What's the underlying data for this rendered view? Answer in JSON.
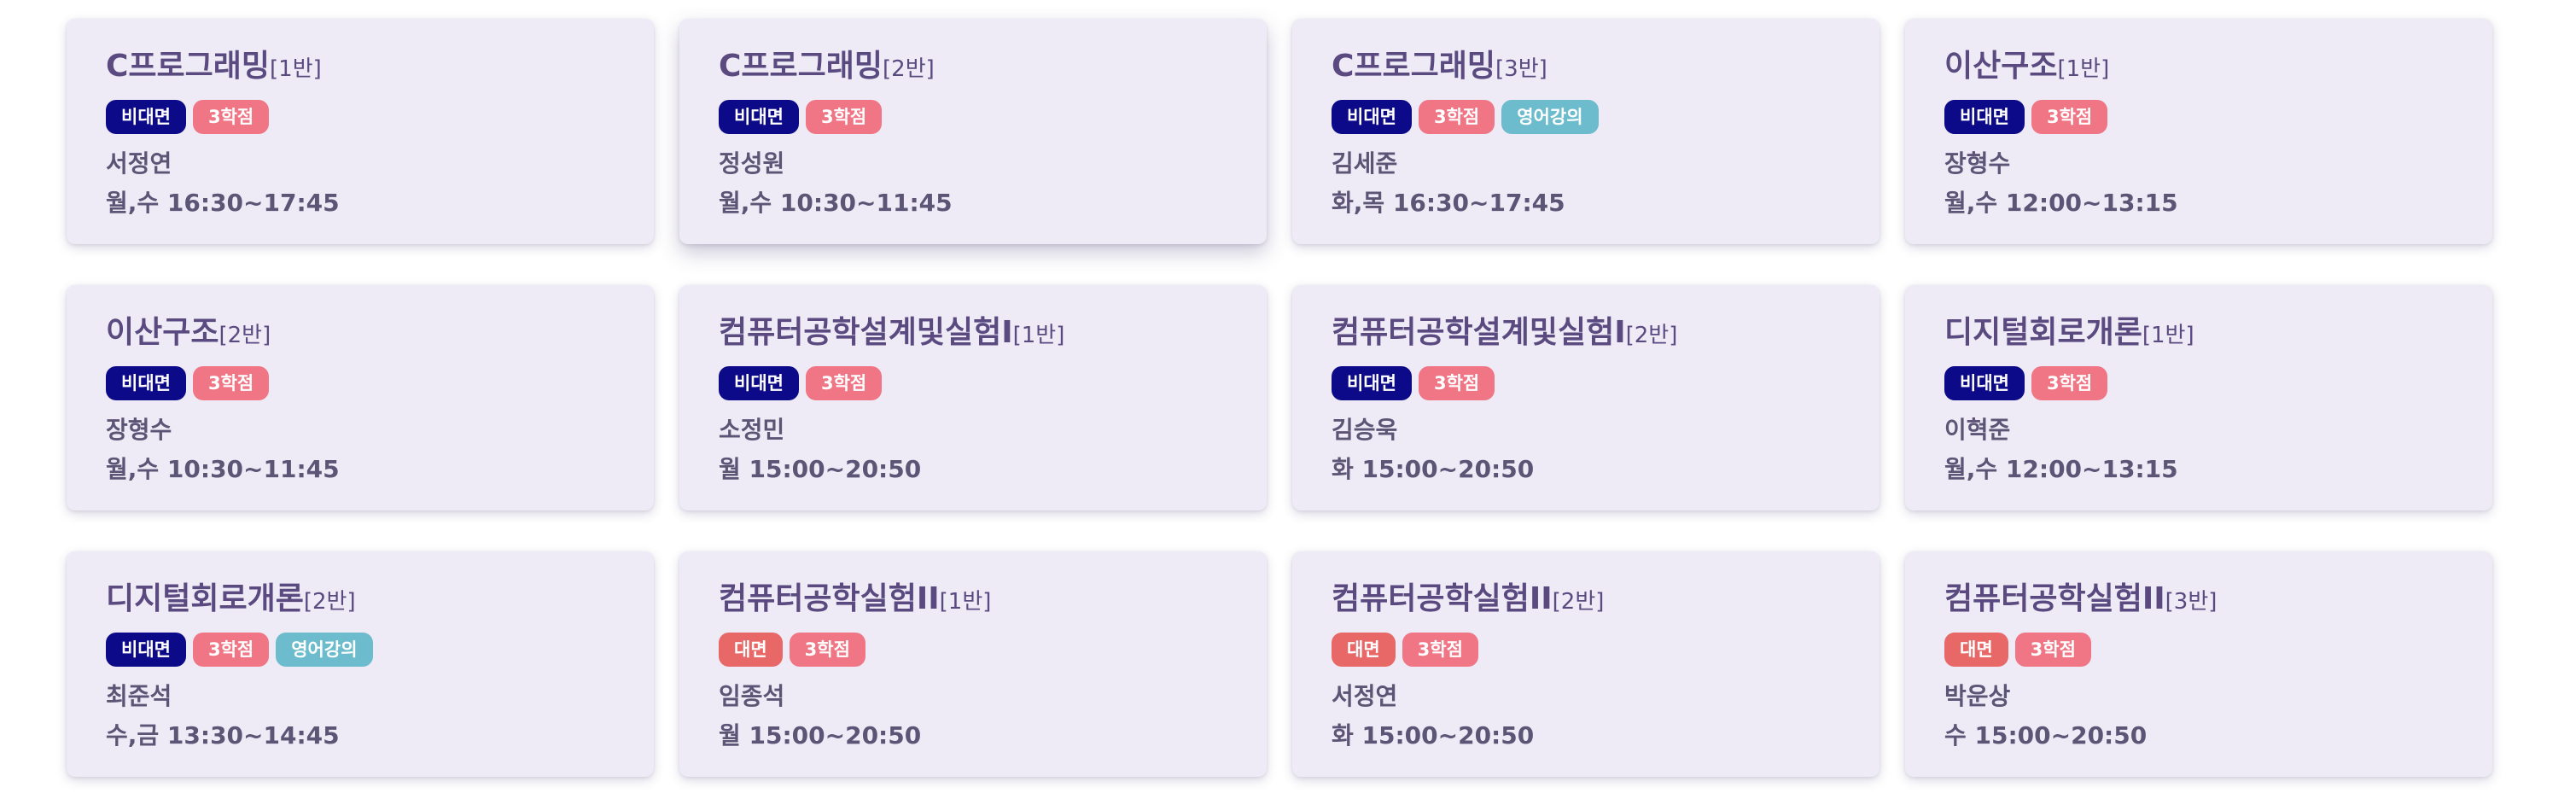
{
  "courses": [
    {
      "name": "C프로그래밍",
      "section": "[1반]",
      "tags": [
        {
          "label": "비대면",
          "kind": "online"
        },
        {
          "label": "3학점",
          "kind": "credit"
        }
      ],
      "professor": "서정연",
      "time": "월,수 16:30~17:45"
    },
    {
      "name": "C프로그래밍",
      "section": "[2반]",
      "tags": [
        {
          "label": "비대면",
          "kind": "online"
        },
        {
          "label": "3학점",
          "kind": "credit"
        }
      ],
      "professor": "정성원",
      "time": "월,수 10:30~11:45"
    },
    {
      "name": "C프로그래밍",
      "section": "[3반]",
      "tags": [
        {
          "label": "비대면",
          "kind": "online"
        },
        {
          "label": "3학점",
          "kind": "credit"
        },
        {
          "label": "영어강의",
          "kind": "english"
        }
      ],
      "professor": "김세준",
      "time": "화,목 16:30~17:45"
    },
    {
      "name": "이산구조",
      "section": "[1반]",
      "tags": [
        {
          "label": "비대면",
          "kind": "online"
        },
        {
          "label": "3학점",
          "kind": "credit"
        }
      ],
      "professor": "장형수",
      "time": "월,수 12:00~13:15"
    },
    {
      "name": "이산구조",
      "section": "[2반]",
      "tags": [
        {
          "label": "비대면",
          "kind": "online"
        },
        {
          "label": "3학점",
          "kind": "credit"
        }
      ],
      "professor": "장형수",
      "time": "월,수 10:30~11:45"
    },
    {
      "name": "컴퓨터공학설계및실험I",
      "section": "[1반]",
      "tags": [
        {
          "label": "비대면",
          "kind": "online"
        },
        {
          "label": "3학점",
          "kind": "credit"
        }
      ],
      "professor": "소정민",
      "time": "월 15:00~20:50"
    },
    {
      "name": "컴퓨터공학설계및실험I",
      "section": "[2반]",
      "tags": [
        {
          "label": "비대면",
          "kind": "online"
        },
        {
          "label": "3학점",
          "kind": "credit"
        }
      ],
      "professor": "김승욱",
      "time": "화 15:00~20:50"
    },
    {
      "name": "디지털회로개론",
      "section": "[1반]",
      "tags": [
        {
          "label": "비대면",
          "kind": "online"
        },
        {
          "label": "3학점",
          "kind": "credit"
        }
      ],
      "professor": "이혁준",
      "time": "월,수 12:00~13:15"
    },
    {
      "name": "디지털회로개론",
      "section": "[2반]",
      "tags": [
        {
          "label": "비대면",
          "kind": "online"
        },
        {
          "label": "3학점",
          "kind": "credit"
        },
        {
          "label": "영어강의",
          "kind": "english"
        }
      ],
      "professor": "최준석",
      "time": "수,금 13:30~14:45"
    },
    {
      "name": "컴퓨터공학실험II",
      "section": "[1반]",
      "tags": [
        {
          "label": "대면",
          "kind": "offline"
        },
        {
          "label": "3학점",
          "kind": "credit"
        }
      ],
      "professor": "임종석",
      "time": "월 15:00~20:50"
    },
    {
      "name": "컴퓨터공학실험II",
      "section": "[2반]",
      "tags": [
        {
          "label": "대면",
          "kind": "offline"
        },
        {
          "label": "3학점",
          "kind": "credit"
        }
      ],
      "professor": "서정연",
      "time": "화 15:00~20:50"
    },
    {
      "name": "컴퓨터공학실험II",
      "section": "[3반]",
      "tags": [
        {
          "label": "대면",
          "kind": "offline"
        },
        {
          "label": "3학점",
          "kind": "credit"
        }
      ],
      "professor": "박운상",
      "time": "수 15:00~20:50"
    }
  ],
  "colors": {
    "card_background": "#eeebf7",
    "title": "#5a4a80",
    "text": "#5d5575",
    "tag_online": "#0d0a8a",
    "tag_offline": "#e86868",
    "tag_credit": "#f07585",
    "tag_english": "#6cbccd"
  }
}
